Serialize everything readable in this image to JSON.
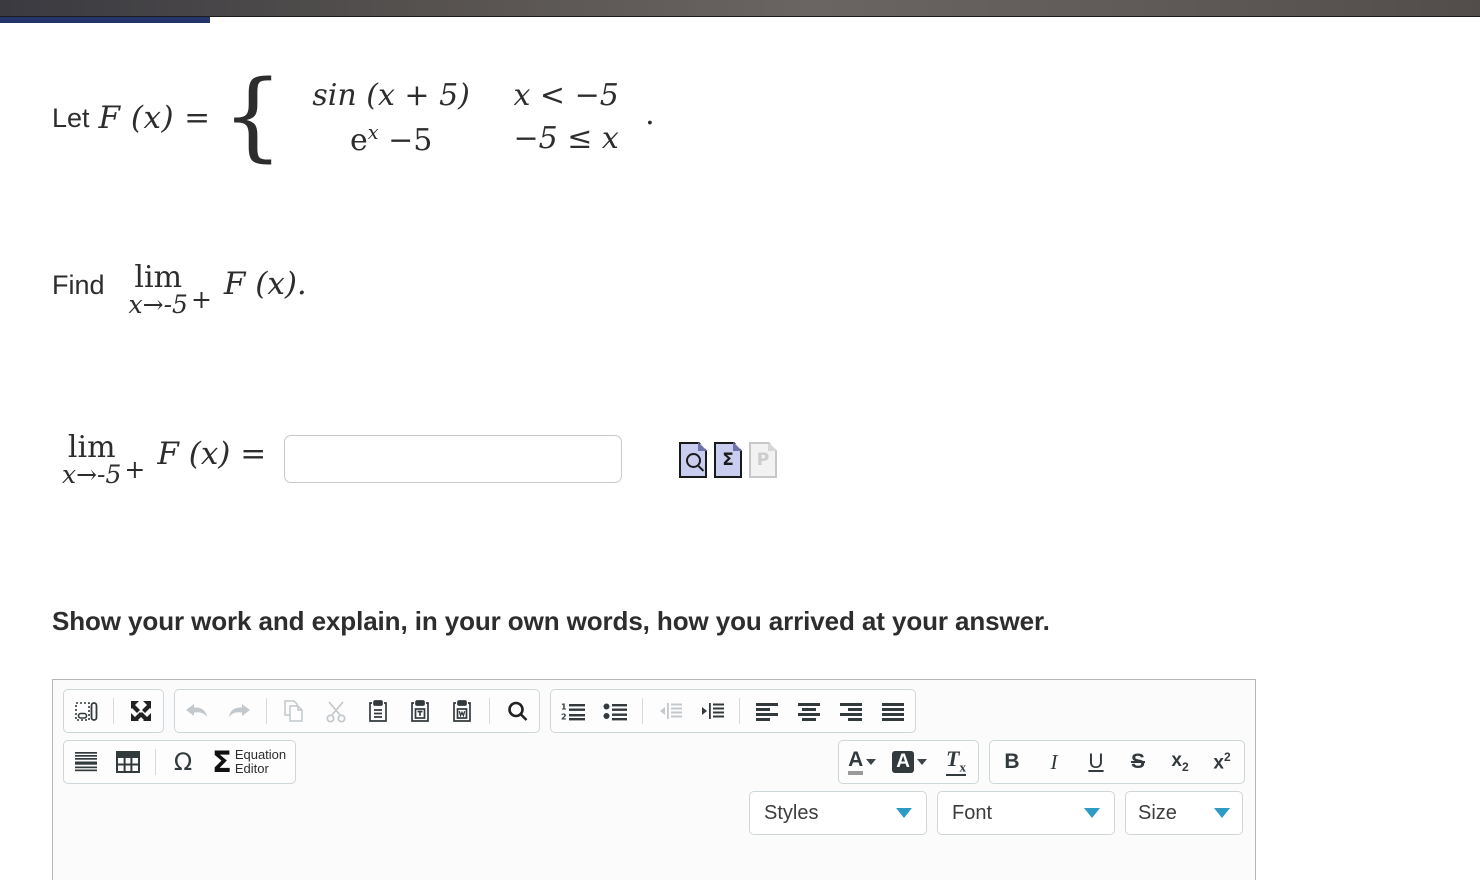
{
  "top_bar": {
    "progress_percent": 14,
    "progress_color": "#23356b",
    "chrome_color": "#55514f"
  },
  "problem": {
    "let_label": "Let",
    "function_name": "F (x)",
    "equals": "=",
    "cases": [
      {
        "expression": "sin (x + 5)",
        "condition": "x < −5"
      },
      {
        "expression_base": "e",
        "expression_exponent": "x",
        "expression_tail": "−5",
        "condition": "−5 ≤ x"
      }
    ],
    "trailing_period": "."
  },
  "question": {
    "find_label": "Find",
    "limit_operator": "lim",
    "limit_subscript": "x→-5",
    "limit_side": "+",
    "limit_function": "F (x)."
  },
  "answer": {
    "limit_operator": "lim",
    "limit_subscript": "x→-5",
    "limit_side": "+",
    "limit_function": "F (x) =",
    "input_value": "",
    "input_placeholder": "",
    "helper_icons": [
      {
        "name": "preview-answer-icon",
        "glyph": "magnifier",
        "disabled": false
      },
      {
        "name": "math-symbols-icon",
        "glyph": "Σ",
        "disabled": false
      },
      {
        "name": "print-answer-icon",
        "glyph": "P",
        "disabled": true
      }
    ]
  },
  "instruction": {
    "text": "Show your work and explain, in your own words, how you arrived at your answer."
  },
  "editor": {
    "toolbar_row_1": {
      "group_1": [
        {
          "name": "show-blocks-icon",
          "label": "Show Blocks",
          "disabled": false
        },
        {
          "name": "maximize-icon",
          "label": "Maximize",
          "disabled": false
        }
      ],
      "group_2": [
        {
          "name": "undo-icon",
          "label": "Undo",
          "disabled": true
        },
        {
          "name": "redo-icon",
          "label": "Redo",
          "disabled": true
        },
        {
          "name": "copy-icon",
          "label": "Copy",
          "disabled": true
        },
        {
          "name": "cut-icon",
          "label": "Cut",
          "disabled": true
        },
        {
          "name": "paste-icon",
          "label": "Paste",
          "disabled": false
        },
        {
          "name": "paste-as-text-icon",
          "label": "Paste as plain text",
          "disabled": false
        },
        {
          "name": "paste-from-word-icon",
          "label": "Paste from Word",
          "disabled": false
        },
        {
          "name": "find-icon",
          "label": "Find",
          "disabled": false
        }
      ],
      "group_3": [
        {
          "name": "numbered-list-icon",
          "label": "Insert/Remove Numbered List",
          "disabled": false
        },
        {
          "name": "bulleted-list-icon",
          "label": "Insert/Remove Bulleted List",
          "disabled": false
        },
        {
          "name": "outdent-icon",
          "label": "Decrease Indent",
          "disabled": true
        },
        {
          "name": "indent-icon",
          "label": "Increase Indent",
          "disabled": false
        },
        {
          "name": "align-left-icon",
          "label": "Align Left",
          "disabled": false
        },
        {
          "name": "align-center-icon",
          "label": "Center",
          "disabled": false
        },
        {
          "name": "align-right-icon",
          "label": "Align Right",
          "disabled": false
        },
        {
          "name": "justify-icon",
          "label": "Justify",
          "disabled": false
        }
      ]
    },
    "toolbar_row_2": {
      "group_1": [
        {
          "name": "horizontal-rule-icon",
          "label": "Insert Horizontal Line",
          "disabled": false
        },
        {
          "name": "table-icon",
          "label": "Table",
          "disabled": false
        },
        {
          "name": "special-character-icon",
          "label": "Ω",
          "disabled": false
        }
      ],
      "equation_editor": {
        "sigma": "Σ",
        "label_line_1": "Equation",
        "label_line_2": "Editor"
      },
      "group_color": [
        {
          "name": "text-color-icon",
          "label": "A",
          "disabled": false
        },
        {
          "name": "background-color-icon",
          "label": "A",
          "disabled": false
        },
        {
          "name": "remove-format-icon",
          "label": "Tx",
          "disabled": false
        }
      ],
      "group_format": [
        {
          "name": "bold-icon",
          "label": "B",
          "disabled": false
        },
        {
          "name": "italic-icon",
          "label": "I",
          "disabled": false
        },
        {
          "name": "underline-icon",
          "label": "U",
          "disabled": false
        },
        {
          "name": "strikethrough-icon",
          "label": "S",
          "disabled": false
        },
        {
          "name": "subscript-icon",
          "label": "x",
          "sub": "2",
          "disabled": false
        },
        {
          "name": "superscript-icon",
          "label": "x",
          "sup": "2",
          "disabled": false
        }
      ]
    },
    "dropdowns": [
      {
        "name": "styles-dropdown",
        "label": "Styles"
      },
      {
        "name": "font-dropdown",
        "label": "Font"
      },
      {
        "name": "size-dropdown",
        "label": "Size"
      }
    ]
  }
}
